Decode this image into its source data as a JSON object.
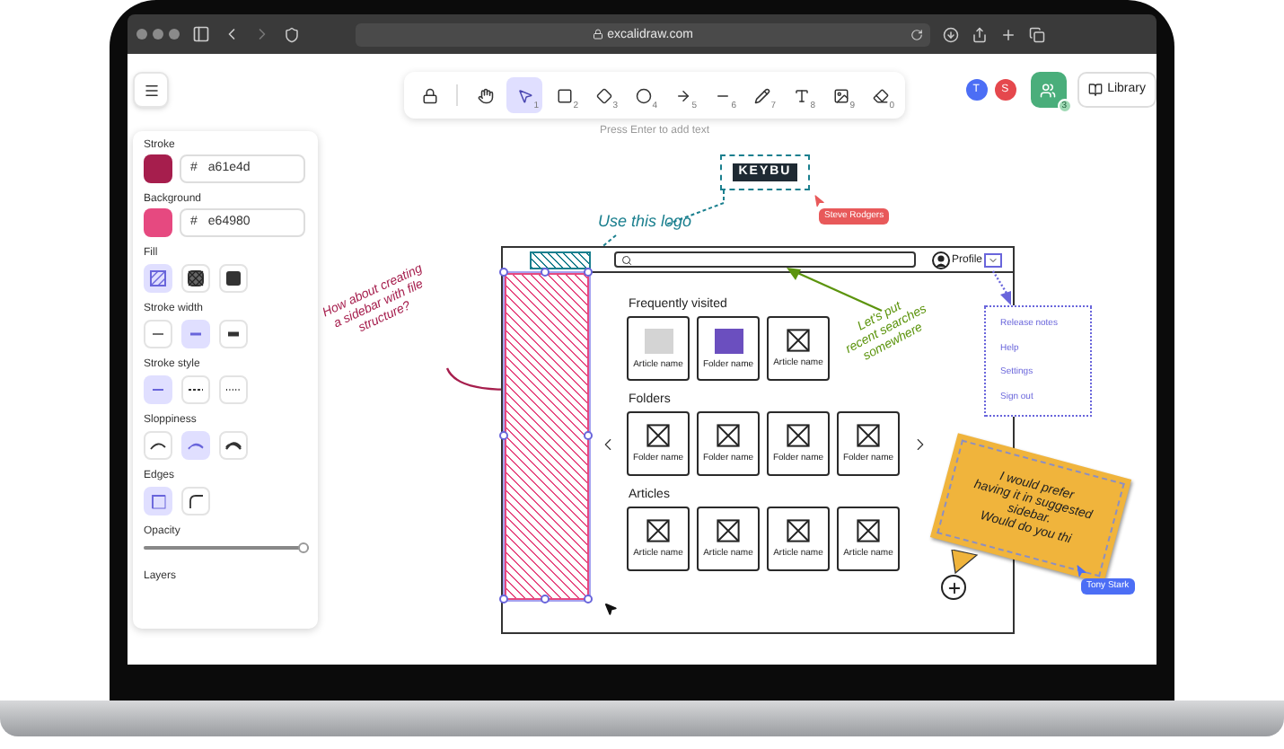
{
  "browser": {
    "url": "excalidraw.com"
  },
  "toolbar": {
    "tools": [
      {
        "kind": "lock",
        "selected": false
      },
      {
        "kind": "hand",
        "selected": false
      },
      {
        "kind": "select",
        "shortcut": "1",
        "selected": true
      },
      {
        "kind": "rectangle",
        "shortcut": "2",
        "selected": false
      },
      {
        "kind": "diamond",
        "shortcut": "3",
        "selected": false
      },
      {
        "kind": "ellipse",
        "shortcut": "4",
        "selected": false
      },
      {
        "kind": "arrow",
        "shortcut": "5",
        "selected": false
      },
      {
        "kind": "line",
        "shortcut": "6",
        "selected": false
      },
      {
        "kind": "pencil",
        "shortcut": "7",
        "selected": false
      },
      {
        "kind": "text",
        "shortcut": "8",
        "selected": false
      },
      {
        "kind": "image",
        "shortcut": "9",
        "selected": false
      },
      {
        "kind": "eraser",
        "shortcut": "0",
        "selected": false
      }
    ]
  },
  "canvas_hint": "Press Enter to add text",
  "collaborators": [
    {
      "initial": "T",
      "color": "#4c6ef5"
    },
    {
      "initial": "S",
      "color": "#e5484d"
    }
  ],
  "share_button": {
    "badge": "3"
  },
  "library_button": {
    "label": "Library"
  },
  "properties": {
    "colors": [
      {
        "label": "Stroke",
        "color": "#a61e4d",
        "prefix": "#",
        "value": "a61e4d"
      },
      {
        "label": "Background",
        "color": "#e64980",
        "prefix": "#",
        "value": "e64980"
      }
    ],
    "option_groups": [
      {
        "label": "Fill",
        "options": [
          {
            "kind": "hachure",
            "selected": true
          },
          {
            "kind": "cross-hatch",
            "selected": false
          },
          {
            "kind": "solid",
            "selected": false
          }
        ]
      },
      {
        "label": "Stroke width",
        "options": [
          {
            "kind": "thin",
            "selected": false
          },
          {
            "kind": "bold",
            "selected": true
          },
          {
            "kind": "extra-bold",
            "selected": false
          }
        ]
      },
      {
        "label": "Stroke style",
        "options": [
          {
            "kind": "solid-line",
            "selected": true
          },
          {
            "kind": "dashed",
            "selected": false
          },
          {
            "kind": "dotted",
            "selected": false
          }
        ]
      },
      {
        "label": "Sloppiness",
        "options": [
          {
            "kind": "architect",
            "selected": false
          },
          {
            "kind": "artist",
            "selected": true
          },
          {
            "kind": "cartoonist",
            "selected": false
          }
        ]
      },
      {
        "label": "Edges",
        "options": [
          {
            "kind": "sharp",
            "selected": true
          },
          {
            "kind": "round",
            "selected": false
          }
        ]
      }
    ],
    "opacity": {
      "label": "Opacity",
      "level": 1
    },
    "layers": {
      "label": "Layers"
    }
  },
  "canvas": {
    "logo": {
      "text": "KEYBU"
    },
    "logo_note": "Use this logo",
    "sidebar_note": [
      "How about creating",
      "a sidebar with file",
      "structure?"
    ],
    "search_note": [
      "Let's put",
      "recent searches",
      "somewhere"
    ],
    "sticky_note": [
      "I would prefer",
      "having it in suggested",
      "sidebar.",
      "Would do you thi"
    ],
    "cursors": [
      {
        "name": "Steve Rodgers",
        "color": "#e8595a"
      },
      {
        "name": "Tony Stark",
        "color": "#4c6ef5"
      }
    ],
    "wireframe": {
      "profile_label": "Profile",
      "sections": [
        {
          "title": "Frequently visited",
          "carousel": false,
          "cards": [
            {
              "kind": "photo",
              "color": "#d4d4d4",
              "label": "Article name"
            },
            {
              "kind": "photo",
              "color": "#6b4fbf",
              "label": "Folder name"
            },
            {
              "kind": "placeholder",
              "label": "Article name"
            }
          ]
        },
        {
          "title": "Folders",
          "carousel": true,
          "cards": [
            {
              "kind": "placeholder",
              "label": "Folder name"
            },
            {
              "kind": "placeholder",
              "label": "Folder name"
            },
            {
              "kind": "placeholder",
              "label": "Folder name"
            },
            {
              "kind": "placeholder",
              "label": "Folder name"
            }
          ]
        },
        {
          "title": "Articles",
          "carousel": false,
          "cards": [
            {
              "kind": "placeholder",
              "label": "Article name"
            },
            {
              "kind": "placeholder",
              "label": "Article name"
            },
            {
              "kind": "placeholder",
              "label": "Article name"
            },
            {
              "kind": "placeholder",
              "label": "Article name"
            }
          ]
        }
      ],
      "menu": [
        "Release notes",
        "Help",
        "Settings",
        "Sign out"
      ]
    }
  }
}
